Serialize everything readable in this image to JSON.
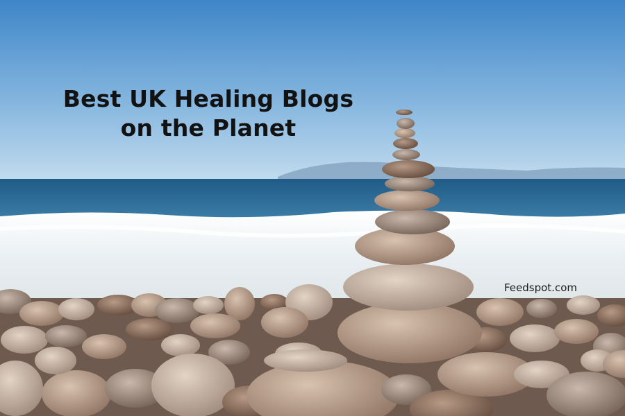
{
  "headline": {
    "line1": "Best UK Healing Blogs",
    "line2": "on the Planet"
  },
  "watermark": "Feedspot.com",
  "colors": {
    "sky_top": "#3f86c9",
    "sky_bottom": "#b6d4ea",
    "sea": "#25628f",
    "foam": "#eef3f5",
    "stone": "#a88c7a"
  }
}
